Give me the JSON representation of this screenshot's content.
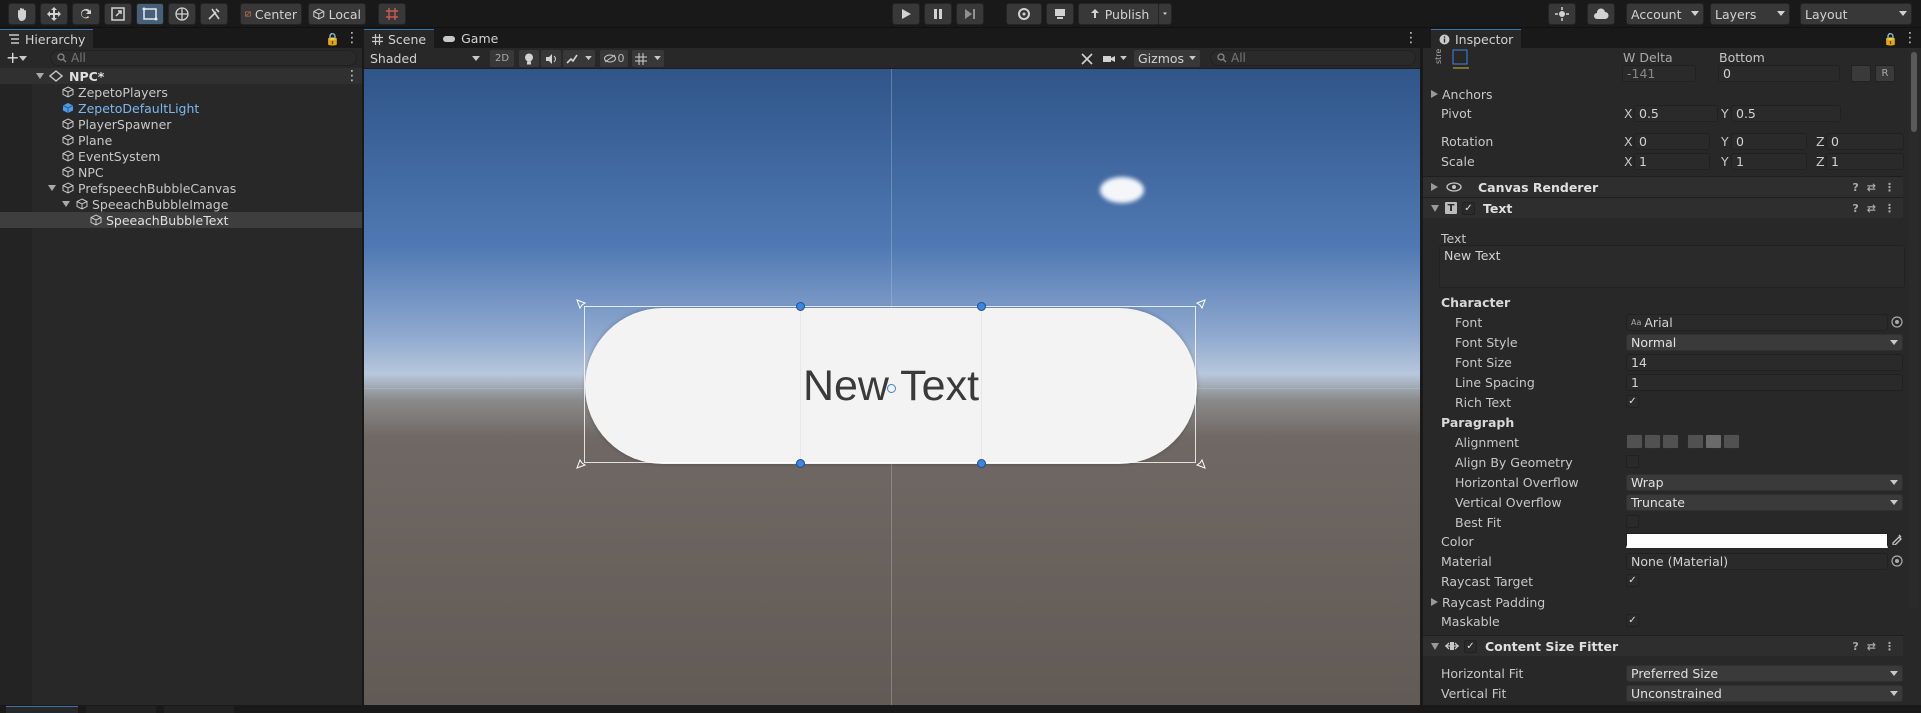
{
  "toolbar": {
    "center_label": "Center",
    "local_label": "Local",
    "publish_label": "Publish",
    "account_label": "Account",
    "layers_label": "Layers",
    "layout_label": "Layout"
  },
  "hierarchy": {
    "tab_label": "Hierarchy",
    "search_placeholder": "All",
    "scene_name": "NPC*",
    "items": [
      {
        "label": "ZepetoPlayers"
      },
      {
        "label": "ZepetoDefaultLight"
      },
      {
        "label": "PlayerSpawner"
      },
      {
        "label": "Plane"
      },
      {
        "label": "EventSystem"
      },
      {
        "label": "NPC"
      },
      {
        "label": "PrefspeechBubbleCanvas"
      },
      {
        "label": "SpeeachBubbleImage"
      },
      {
        "label": "SpeeachBubbleText"
      }
    ]
  },
  "scene": {
    "tab_scene": "Scene",
    "tab_game": "Game",
    "shading_mode": "Shaded",
    "mode_2d": "2D",
    "hidden_count": "0",
    "gizmos_label": "Gizmos",
    "search_placeholder": "All",
    "canvas_text": "New Text"
  },
  "inspector": {
    "tab_label": "Inspector",
    "w_delta_label": "W Delta",
    "bottom_label": "Bottom",
    "w_delta_value": "-141",
    "bottom_value": "0",
    "anchors_label": "Anchors",
    "pivot_label": "Pivot",
    "pivot_x": "0.5",
    "pivot_y": "0.5",
    "rotation_label": "Rotation",
    "rotation_x": "0",
    "rotation_y": "0",
    "rotation_z": "0",
    "scale_label": "Scale",
    "scale_x": "1",
    "scale_y": "1",
    "scale_z": "1",
    "axis_x": "X",
    "axis_y": "Y",
    "axis_z": "Z",
    "btn_r": "R",
    "canvas_renderer_label": "Canvas Renderer",
    "text_component_label": "Text",
    "text_label": "Text",
    "text_value": "New Text",
    "character_label": "Character",
    "font_label": "Font",
    "font_value": "Arial",
    "font_style_label": "Font Style",
    "font_style_value": "Normal",
    "font_size_label": "Font Size",
    "font_size_value": "14",
    "line_spacing_label": "Line Spacing",
    "line_spacing_value": "1",
    "rich_text_label": "Rich Text",
    "paragraph_label": "Paragraph",
    "alignment_label": "Alignment",
    "align_by_geometry_label": "Align By Geometry",
    "horizontal_overflow_label": "Horizontal Overflow",
    "horizontal_overflow_value": "Wrap",
    "vertical_overflow_label": "Vertical Overflow",
    "vertical_overflow_value": "Truncate",
    "best_fit_label": "Best Fit",
    "color_label": "Color",
    "material_label": "Material",
    "material_value": "None (Material)",
    "raycast_target_label": "Raycast Target",
    "raycast_padding_label": "Raycast Padding",
    "maskable_label": "Maskable",
    "csf_label": "Content Size Fitter",
    "horizontal_fit_label": "Horizontal Fit",
    "horizontal_fit_value": "Preferred Size",
    "vertical_fit_label": "Vertical Fit",
    "vertical_fit_value": "Unconstrained"
  },
  "colors": {
    "accent": "#46607c",
    "selection": "#3a72b0",
    "handle": "#3d86e0",
    "link_text": "#7cb8f0"
  }
}
